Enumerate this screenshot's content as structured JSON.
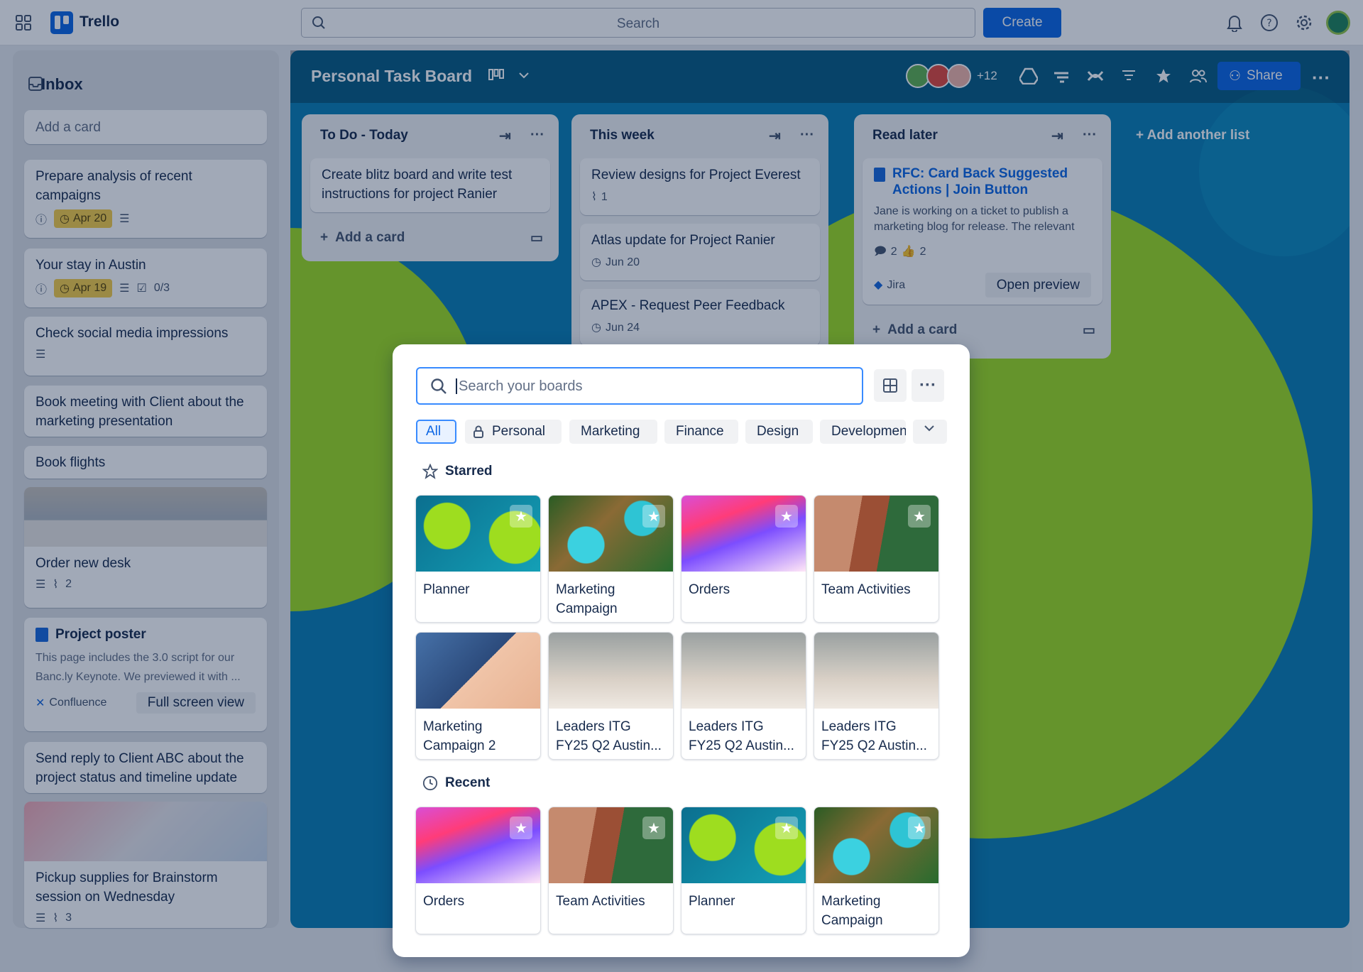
{
  "topbar": {
    "brand": "Trello",
    "search_placeholder": "Search",
    "create_label": "Create"
  },
  "inbox": {
    "title": "Inbox",
    "add_card": "Add a card",
    "cards": [
      {
        "text": "Prepare analysis of recent campaigns",
        "due": "Apr 20"
      },
      {
        "text": "Your stay in Austin",
        "due": "Apr 19",
        "checklist": "0/3"
      },
      {
        "text": "Check social media impressions"
      },
      {
        "text": "Book meeting with Client about the marketing presentation"
      },
      {
        "text": "Book flights"
      },
      {
        "text": "Order new desk",
        "attachments": "2"
      },
      {
        "text": "Project poster",
        "desc": "This page includes the 3.0 script for our Banc.ly Keynote. We previewed it with ...",
        "source": "Confluence",
        "action": "Full screen view"
      },
      {
        "text": "Send reply to Client ABC about the project status and timeline update"
      },
      {
        "text": "Pickup supplies for Brainstorm session on Wednesday",
        "attachments": "3"
      }
    ]
  },
  "board": {
    "title": "Personal Task Board",
    "member_count": "+12",
    "share_label": "Share",
    "add_list": "Add another list",
    "lists": [
      {
        "name": "To Do - Today",
        "cards": [
          {
            "text": "Create blitz board and write test instructions for project Ranier"
          }
        ],
        "add": "Add a card"
      },
      {
        "name": "This week",
        "cards": [
          {
            "text": "Review designs for Project Everest",
            "attachments": "1"
          },
          {
            "text": "Atlas update for Project Ranier",
            "date": "Jun 20"
          },
          {
            "text": "APEX - Request Peer Feedback",
            "date": "Jun 24"
          }
        ]
      },
      {
        "name": "Read later",
        "cards": [
          {
            "title": "RFC: Card Back Suggested Actions | Join Button",
            "desc": "Jane is working on a ticket to publish a marketing blog for release. The relevant",
            "comments": "2",
            "likes": "2",
            "source": "Jira",
            "action": "Open preview"
          }
        ],
        "add": "Add a card"
      }
    ]
  },
  "switcher": {
    "search_placeholder": "Search your boards",
    "filters": [
      "All",
      "Personal",
      "Marketing",
      "Finance",
      "Design",
      "Development"
    ],
    "starred_label": "Starred",
    "recent_label": "Recent",
    "starred": [
      "Planner",
      "Marketing Campaign",
      "Orders",
      "Team Activities",
      "Marketing Campaign 2",
      "Leaders ITG FY25 Q2 Austin...",
      "Leaders ITG FY25 Q2 Austin...",
      "Leaders ITG FY25 Q2 Austin..."
    ],
    "recent": [
      "Orders",
      "Team Activities",
      "Planner",
      "Marketing Campaign"
    ]
  },
  "colors": {
    "accent": "#0c66e4",
    "due": "#f5cd47",
    "board_bg": "#0a7fb3"
  }
}
